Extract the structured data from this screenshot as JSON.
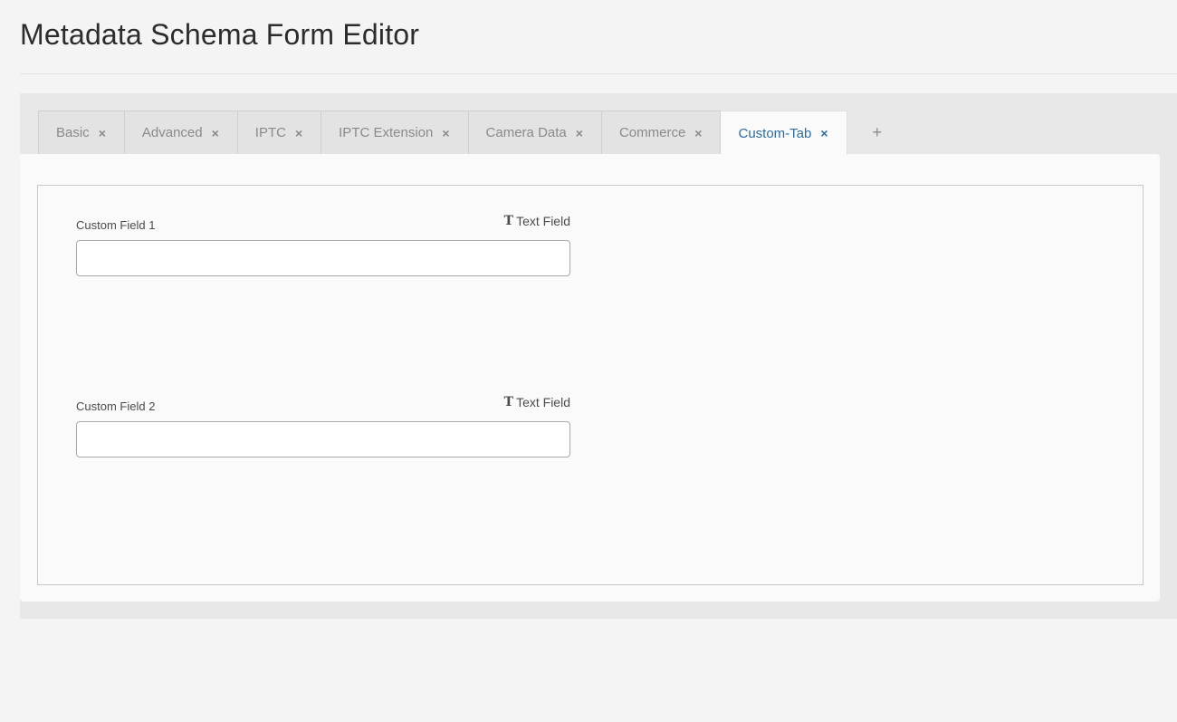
{
  "page": {
    "title": "Metadata Schema Form Editor"
  },
  "tabs": [
    {
      "label": "Basic",
      "active": false,
      "close_icon": "close-icon"
    },
    {
      "label": "Advanced",
      "active": false,
      "close_icon": "close-icon"
    },
    {
      "label": "IPTC",
      "active": false,
      "close_icon": "close-icon"
    },
    {
      "label": "IPTC Extension",
      "active": false,
      "close_icon": "close-icon"
    },
    {
      "label": "Camera Data",
      "active": false,
      "close_icon": "close-icon"
    },
    {
      "label": "Commerce",
      "active": false,
      "close_icon": "close-icon"
    },
    {
      "label": "Custom-Tab",
      "active": true,
      "close_icon": "close-icon"
    }
  ],
  "tab_close_glyph": "×",
  "add_tab": {
    "glyph": "+",
    "icon": "plus-icon"
  },
  "fields": [
    {
      "label": "Custom Field 1",
      "type_label": "Text Field",
      "type_icon_glyph": "T",
      "type_icon": "text-type-icon",
      "value": "",
      "placeholder": ""
    },
    {
      "label": "Custom Field 2",
      "type_label": "Text Field",
      "type_icon_glyph": "T",
      "type_icon": "text-type-icon",
      "value": "",
      "placeholder": ""
    }
  ],
  "colors": {
    "active_tab_text": "#2d6ca2",
    "inactive_tab_text": "#8a8a8a",
    "page_background": "#f4f4f4"
  }
}
